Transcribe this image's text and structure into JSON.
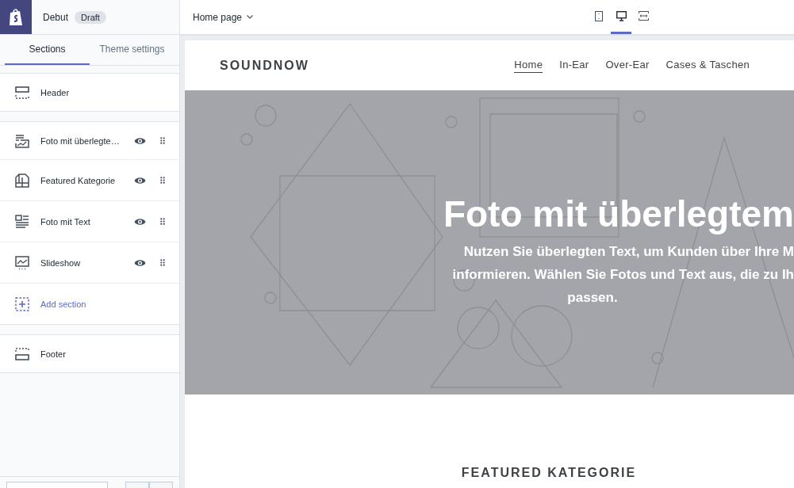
{
  "editor": {
    "theme_name": "Debut",
    "status_badge": "Draft"
  },
  "sidebar_tabs": [
    {
      "label": "Sections",
      "selected": true
    },
    {
      "label": "Theme settings",
      "selected": false
    }
  ],
  "header_section": {
    "label": "Header"
  },
  "content_sections": [
    {
      "label": "Foto mit überlegte…",
      "kind": "image-overlay"
    },
    {
      "label": "Featured Kategorie",
      "kind": "collection"
    },
    {
      "label": "Foto mit Text",
      "kind": "image-text"
    },
    {
      "label": "Slideshow",
      "kind": "slideshow"
    }
  ],
  "add_section": {
    "label": "Add section"
  },
  "footer_section": {
    "label": "Footer"
  },
  "page_selector": "Home page",
  "device_views": [
    {
      "kind": "mobile",
      "selected": false
    },
    {
      "kind": "desktop",
      "selected": true
    },
    {
      "kind": "full-width",
      "selected": false
    }
  ],
  "store": {
    "logo": "SOUNDNOW",
    "nav": [
      {
        "label": "Home",
        "selected": true
      },
      {
        "label": "In-Ear",
        "selected": false
      },
      {
        "label": "Over-Ear",
        "selected": false
      },
      {
        "label": "Cases & Taschen",
        "selected": false
      }
    ]
  },
  "hero": {
    "title": "Foto mit überlegtem",
    "text_lines": [
      "Nutzen Sie überlegten Text, um Kunden über Ihre M",
      "informieren. Wählen Sie Fotos und Text aus, die zu Ih",
      "passen."
    ]
  },
  "featured_heading": "FEATURED KATEGORIE"
}
